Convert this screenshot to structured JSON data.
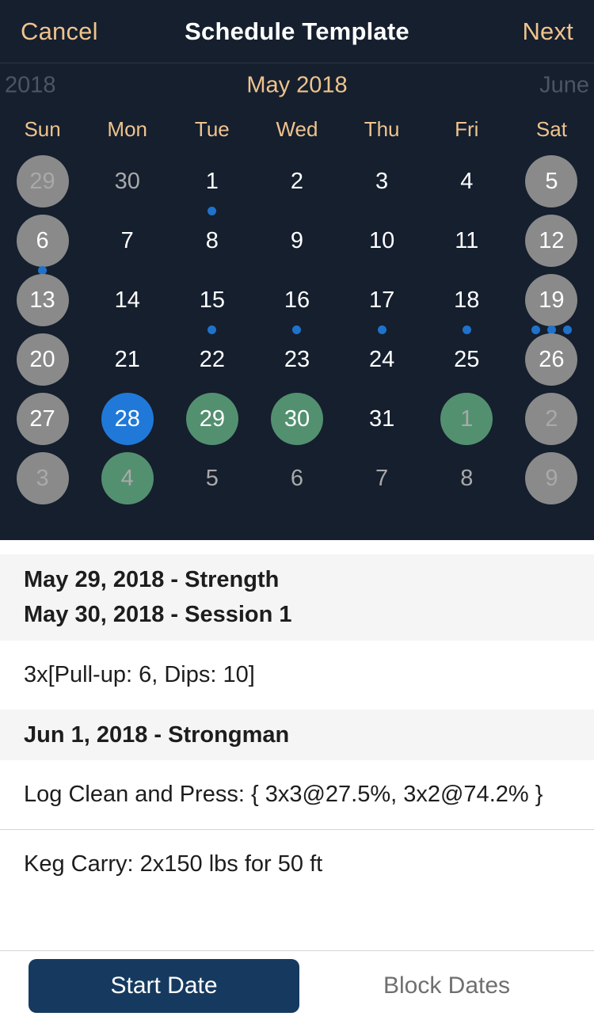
{
  "navbar": {
    "cancel_label": "Cancel",
    "title": "Schedule Template",
    "next_label": "Next",
    "accent_color": "#efc38d"
  },
  "calendar": {
    "prev_month_label": "2018",
    "current_month_label": "May 2018",
    "next_month_label": "June",
    "weekdays": [
      "Sun",
      "Mon",
      "Tue",
      "Wed",
      "Thu",
      "Fri",
      "Sat"
    ],
    "colors": {
      "background": "#151f2e",
      "weekend_circle": "#8a8a8a",
      "selected_circle": "#2079d8",
      "scheduled_circle": "#539070",
      "dot": "#1f72cc",
      "muted_text": "#a9a9a9"
    },
    "weeks": [
      [
        {
          "day": "29",
          "style": "weekend muted",
          "dots": 0
        },
        {
          "day": "30",
          "style": "othermonth",
          "dots": 0
        },
        {
          "day": "1",
          "style": "",
          "dots": 1
        },
        {
          "day": "2",
          "style": "",
          "dots": 0
        },
        {
          "day": "3",
          "style": "",
          "dots": 0
        },
        {
          "day": "4",
          "style": "",
          "dots": 0
        },
        {
          "day": "5",
          "style": "weekend",
          "dots": 0
        }
      ],
      [
        {
          "day": "6",
          "style": "weekend",
          "dots": 1
        },
        {
          "day": "7",
          "style": "",
          "dots": 0
        },
        {
          "day": "8",
          "style": "",
          "dots": 0
        },
        {
          "day": "9",
          "style": "",
          "dots": 0
        },
        {
          "day": "10",
          "style": "",
          "dots": 0
        },
        {
          "day": "11",
          "style": "",
          "dots": 0
        },
        {
          "day": "12",
          "style": "weekend",
          "dots": 0
        }
      ],
      [
        {
          "day": "13",
          "style": "weekend",
          "dots": 0
        },
        {
          "day": "14",
          "style": "",
          "dots": 0
        },
        {
          "day": "15",
          "style": "",
          "dots": 1
        },
        {
          "day": "16",
          "style": "",
          "dots": 1
        },
        {
          "day": "17",
          "style": "",
          "dots": 1
        },
        {
          "day": "18",
          "style": "",
          "dots": 1
        },
        {
          "day": "19",
          "style": "weekend",
          "dots": 3
        }
      ],
      [
        {
          "day": "20",
          "style": "weekend",
          "dots": 0
        },
        {
          "day": "21",
          "style": "",
          "dots": 0
        },
        {
          "day": "22",
          "style": "",
          "dots": 0
        },
        {
          "day": "23",
          "style": "",
          "dots": 0
        },
        {
          "day": "24",
          "style": "",
          "dots": 0
        },
        {
          "day": "25",
          "style": "",
          "dots": 0
        },
        {
          "day": "26",
          "style": "weekend",
          "dots": 0
        }
      ],
      [
        {
          "day": "27",
          "style": "weekend",
          "dots": 0
        },
        {
          "day": "28",
          "style": "selected",
          "dots": 0
        },
        {
          "day": "29",
          "style": "scheduled",
          "dots": 0
        },
        {
          "day": "30",
          "style": "scheduled",
          "dots": 0
        },
        {
          "day": "31",
          "style": "",
          "dots": 0
        },
        {
          "day": "1",
          "style": "scheduled muted",
          "dots": 0
        },
        {
          "day": "2",
          "style": "weekend muted",
          "dots": 0
        }
      ],
      [
        {
          "day": "3",
          "style": "weekend muted",
          "dots": 0
        },
        {
          "day": "4",
          "style": "scheduled muted",
          "dots": 0
        },
        {
          "day": "5",
          "style": "othermonth",
          "dots": 0
        },
        {
          "day": "6",
          "style": "othermonth",
          "dots": 0
        },
        {
          "day": "7",
          "style": "othermonth",
          "dots": 0
        },
        {
          "day": "8",
          "style": "othermonth",
          "dots": 0
        },
        {
          "day": "9",
          "style": "weekend muted",
          "dots": 0
        }
      ]
    ]
  },
  "list": {
    "header_1": "May 29, 2018 - Strength",
    "header_2": "May 30, 2018 - Session 1",
    "row_1": "3x[Pull-up: 6, Dips: 10]",
    "header_3": "Jun 1, 2018 - Strongman",
    "row_2": "Log Clean and Press: { 3x3@27.5%, 3x2@74.2% }",
    "row_3": "Keg Carry: 2x150 lbs for 50 ft"
  },
  "bottom_bar": {
    "start_date_label": "Start Date",
    "block_dates_label": "Block Dates",
    "active_color": "#163a5f"
  }
}
